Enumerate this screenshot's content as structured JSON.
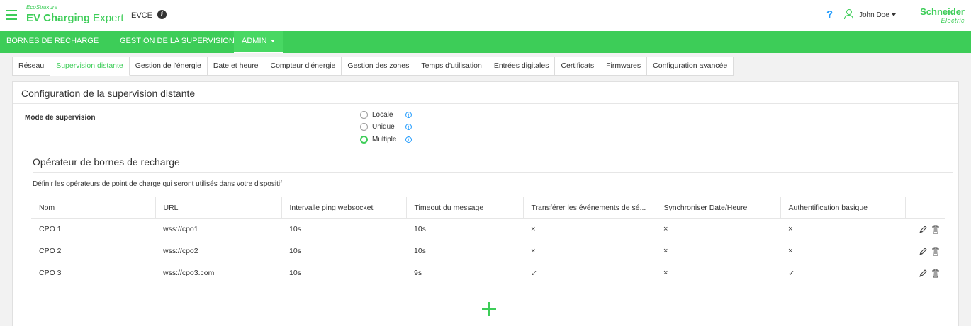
{
  "header": {
    "brand_eco": "EcoStruxure",
    "brand_name_bold": "EV Charging",
    "brand_name_light": " Expert",
    "device_name": "EVCE",
    "help_label": "?",
    "user_name": "John Doe",
    "logo_line1": "Schneider",
    "logo_line2": "Electric",
    "accent_color": "#3dcd58"
  },
  "main_nav": {
    "items": [
      {
        "label": "BORNES DE RECHARGE"
      },
      {
        "label": "GESTION DE LA SUPERVISION"
      },
      {
        "label": "ADMIN",
        "active": true
      }
    ]
  },
  "tabs": [
    {
      "label": "Réseau"
    },
    {
      "label": "Supervision distante",
      "active": true
    },
    {
      "label": "Gestion de l'énergie"
    },
    {
      "label": "Date et heure"
    },
    {
      "label": "Compteur d'énergie"
    },
    {
      "label": "Gestion des zones"
    },
    {
      "label": "Temps d'utilisation"
    },
    {
      "label": "Entrées digitales"
    },
    {
      "label": "Certificats"
    },
    {
      "label": "Firmwares"
    },
    {
      "label": "Configuration avancée"
    }
  ],
  "panel": {
    "title": "Configuration de la supervision distante",
    "mode_label": "Mode de supervision",
    "mode_options": [
      {
        "label": "Locale",
        "checked": false
      },
      {
        "label": "Unique",
        "checked": false
      },
      {
        "label": "Multiple",
        "checked": true
      }
    ],
    "info_glyph": "i"
  },
  "operators": {
    "title": "Opérateur de bornes de recharge",
    "description": "Définir les opérateurs de point de charge qui seront utilisés dans votre dispositif",
    "columns": [
      "Nom",
      "URL",
      "Intervalle ping websocket",
      "Timeout du message",
      "Transférer les événements de sé...",
      "Synchroniser Date/Heure",
      "Authentification basique",
      ""
    ],
    "rows": [
      {
        "name": "CPO 1",
        "url": "wss://cpo1",
        "ping": "10s",
        "timeout": "10s",
        "transfer": "×",
        "sync": "×",
        "auth": "×"
      },
      {
        "name": "CPO 2",
        "url": "wss://cpo2",
        "ping": "10s",
        "timeout": "10s",
        "transfer": "×",
        "sync": "×",
        "auth": "×"
      },
      {
        "name": "CPO 3",
        "url": "wss://cpo3.com",
        "ping": "10s",
        "timeout": "9s",
        "transfer": "✓",
        "sync": "×",
        "auth": "✓"
      }
    ]
  }
}
